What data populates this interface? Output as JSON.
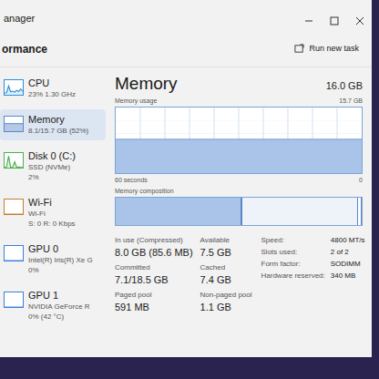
{
  "window": {
    "title": "anager"
  },
  "header": {
    "title": "ormance",
    "action": "Run new task"
  },
  "sidebar": {
    "items": [
      {
        "name": "CPU",
        "details": [
          "23% 1.30 GHz"
        ],
        "selected": false,
        "color": "#2b8fd6",
        "values": [
          10,
          15,
          60,
          20,
          25,
          18,
          30,
          22,
          40,
          23
        ]
      },
      {
        "name": "Memory",
        "details": [
          "8.1/15.7 GB (52%)"
        ],
        "selected": true,
        "color": "#5b87c9",
        "values": [
          52,
          52,
          52,
          52,
          52,
          52,
          52,
          52,
          52,
          52
        ]
      },
      {
        "name": "Disk 0 (C:)",
        "details": [
          "SSD (NVMe)",
          "2%"
        ],
        "selected": false,
        "color": "#4caf50",
        "values": [
          2,
          5,
          80,
          3,
          2,
          40,
          2,
          6,
          2,
          2
        ]
      },
      {
        "name": "Wi-Fi",
        "details": [
          "Wi-Fi",
          "S: 0 R: 0 Kbps"
        ],
        "selected": false,
        "color": "#c77d2e",
        "values": [
          0,
          0,
          0,
          0,
          0,
          0,
          0,
          0,
          0,
          0
        ]
      },
      {
        "name": "GPU 0",
        "details": [
          "Intel(R) Iris(R) Xe G",
          "0%"
        ],
        "selected": false,
        "color": "#3d7fd9",
        "values": [
          0,
          0,
          0,
          0,
          0,
          0,
          0,
          0,
          0,
          0
        ]
      },
      {
        "name": "GPU 1",
        "details": [
          "NVIDIA GeForce R",
          "0% (42 °C)"
        ],
        "selected": false,
        "color": "#3d7fd9",
        "values": [
          0,
          0,
          0,
          0,
          0,
          0,
          0,
          0,
          0,
          0
        ]
      }
    ]
  },
  "main": {
    "title": "Memory",
    "capacity": "16.0 GB",
    "usage_chart": {
      "label": "Memory usage",
      "max_label": "15.7 GB",
      "axis_max": 15.7,
      "time_label": "60 seconds",
      "min_label": "0",
      "values": [
        8.1,
        8.1,
        8.1,
        8.1,
        8.1,
        8.1,
        8.1,
        8.1,
        8.1,
        8.1,
        8.1,
        8.1
      ]
    },
    "composition": {
      "label": "Memory composition",
      "segments": [
        {
          "kind": "inuse",
          "level": 0.51
        },
        {
          "kind": "modified",
          "level": 0.005
        },
        {
          "kind": "standby",
          "level": 0.47
        },
        {
          "kind": "free",
          "level": 0.015
        }
      ]
    },
    "stats": [
      {
        "label": "In use (Compressed)",
        "value": "8.0 GB (85.6 MB)"
      },
      {
        "label": "Available",
        "value": "7.5 GB"
      },
      {
        "label": "Committed",
        "value": "7.1/18.5 GB"
      },
      {
        "label": "Cached",
        "value": "7.4 GB"
      },
      {
        "label": "Paged pool",
        "value": "591 MB"
      },
      {
        "label": "Non-paged pool",
        "value": "1.1 GB"
      }
    ],
    "hardware": [
      {
        "label": "Speed:",
        "value": "4800 MT/s"
      },
      {
        "label": "Slots used:",
        "value": "2 of 2"
      },
      {
        "label": "Form factor:",
        "value": "SODIMM"
      },
      {
        "label": "Hardware reserved:",
        "value": "340 MB"
      }
    ]
  }
}
